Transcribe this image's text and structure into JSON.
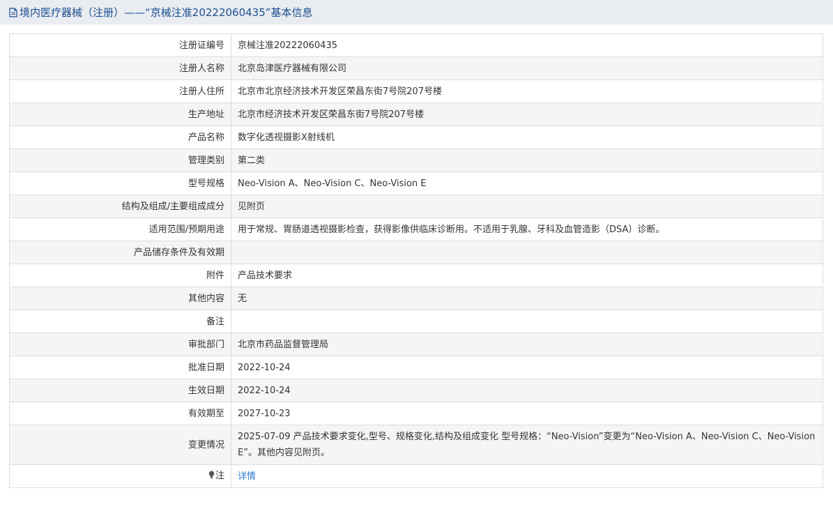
{
  "header": {
    "title": "境内医疗器械（注册）——“京械注准20222060435”基本信息",
    "icon": "document-icon"
  },
  "rows": [
    {
      "label": "注册证编号",
      "value": "京械注准20222060435"
    },
    {
      "label": "注册人名称",
      "value": "北京岛津医疗器械有限公司"
    },
    {
      "label": "注册人住所",
      "value": "北京市北京经济技术开发区荣昌东街7号院207号楼"
    },
    {
      "label": "生产地址",
      "value": "北京市经济技术开发区荣昌东街7号院207号楼"
    },
    {
      "label": "产品名称",
      "value": "数字化透视摄影X射线机"
    },
    {
      "label": "管理类别",
      "value": "第二类"
    },
    {
      "label": "型号规格",
      "value": "Neo-Vision A、Neo-Vision C、Neo-Vision E"
    },
    {
      "label": "结构及组成/主要组成成分",
      "value": "见附页"
    },
    {
      "label": "适用范围/预期用途",
      "value": "用于常规、胃肠道透视摄影检查，获得影像供临床诊断用。不适用于乳腺、牙科及血管造影（DSA）诊断。"
    },
    {
      "label": "产品储存条件及有效期",
      "value": ""
    },
    {
      "label": "附件",
      "value": "产品技术要求"
    },
    {
      "label": "其他内容",
      "value": "无"
    },
    {
      "label": "备注",
      "value": ""
    },
    {
      "label": "审批部门",
      "value": "北京市药品监督管理局"
    },
    {
      "label": "批准日期",
      "value": "2022-10-24"
    },
    {
      "label": "生效日期",
      "value": "2022-10-24"
    },
    {
      "label": "有效期至",
      "value": "2027-10-23"
    },
    {
      "label": "变更情况",
      "value": "2025-07-09 产品技术要求变化,型号、规格变化,结构及组成变化 型号规格：“Neo-Vision”变更为“Neo-Vision A、Neo-Vision C、Neo-Vision E”。其他内容见附页。"
    }
  ],
  "note_row": {
    "label": "注",
    "icon": "lightbulb-icon",
    "link_text": "详情"
  }
}
